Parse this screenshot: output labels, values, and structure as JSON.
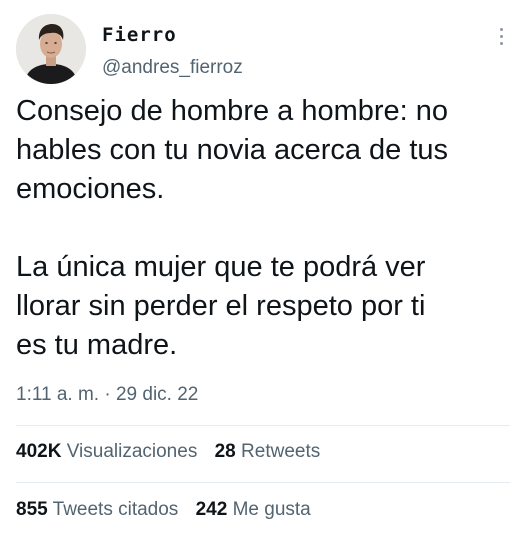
{
  "author": {
    "display_name": "Fierro",
    "handle": "@andres_fierroz",
    "avatar": "profile-photo"
  },
  "tweet": {
    "text": "Consejo de hombre a hombre: no\nhables con tu novia acerca de tus\nemociones.\n\nLa única mujer que te podrá ver\nllorar sin perder el respeto por ti\nes tu madre.",
    "timestamp": "1:11 a. m. · 29 dic. 22"
  },
  "stats": {
    "views_count": "402K",
    "views_label": "Visualizaciones",
    "retweets_count": "28",
    "retweets_label": "Retweets",
    "quotes_count": "855",
    "quotes_label": "Tweets citados",
    "likes_count": "242",
    "likes_label": "Me gusta"
  },
  "icons": {
    "more": "more-options-icon"
  },
  "colors": {
    "text_primary": "#0f1419",
    "text_secondary": "#536471",
    "divider": "#e6ecf0"
  }
}
